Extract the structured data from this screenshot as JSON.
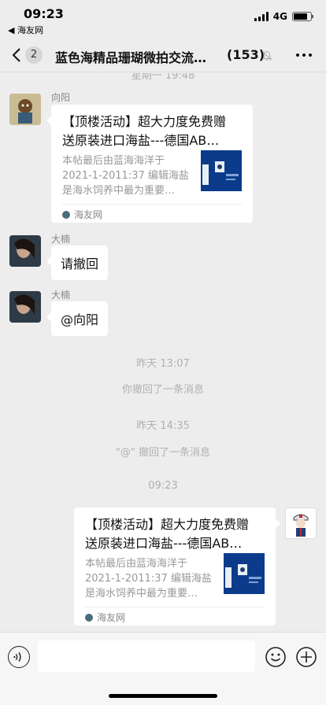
{
  "status_bar": {
    "time": "09:23",
    "back_app": "◀ 海友网",
    "network": "4G",
    "battery_level": 0.8
  },
  "nav": {
    "unread_count": "2",
    "title": "蓝色海精品珊瑚微拍交流…",
    "member_count": "(153)"
  },
  "timestamps": {
    "top": "星期一 19:48",
    "t1": "昨天 13:07",
    "t2": "昨天 14:35",
    "t3": "09:23"
  },
  "system_messages": {
    "recall_1": "你撤回了一条消息",
    "recall_2": "\"@\" 撤回了一条消息"
  },
  "messages": {
    "m1": {
      "sender": "向阳",
      "card_title_line1": "【顶楼活动】超大力度免费赠",
      "card_title_line2": "送原装进口海盐---德国AB…",
      "card_desc_line1": "本帖最后由蓝海海洋于",
      "card_desc_line2": "2021-1-2011:37 编辑海盐",
      "card_desc_line3": "是海水饲养中最为重要…",
      "source": "海友网"
    },
    "m2": {
      "sender": "大楠",
      "text": "请撤回"
    },
    "m3": {
      "sender": "大楠",
      "text": "@向阳"
    },
    "m4": {
      "card_title_line1": "【顶楼活动】超大力度免费赠",
      "card_title_line2": "送原装进口海盐---德国AB…",
      "card_desc_line1": "本帖最后由蓝海海洋于",
      "card_desc_line2": "2021-1-2011:37 编辑海盐",
      "card_desc_line3": "是海水饲养中最为重要…",
      "source": "海友网"
    }
  },
  "icons": {
    "back": "chevron-left-icon",
    "mute": "bell-slash-icon",
    "more": "more-dots-icon",
    "voice": "voice-icon",
    "emoji": "emoji-icon",
    "plus": "plus-icon"
  },
  "colors": {
    "background": "#ededed",
    "bubble": "#ffffff",
    "meta_text": "#b0b0b0",
    "card_thumb": "#0b3b8a"
  }
}
